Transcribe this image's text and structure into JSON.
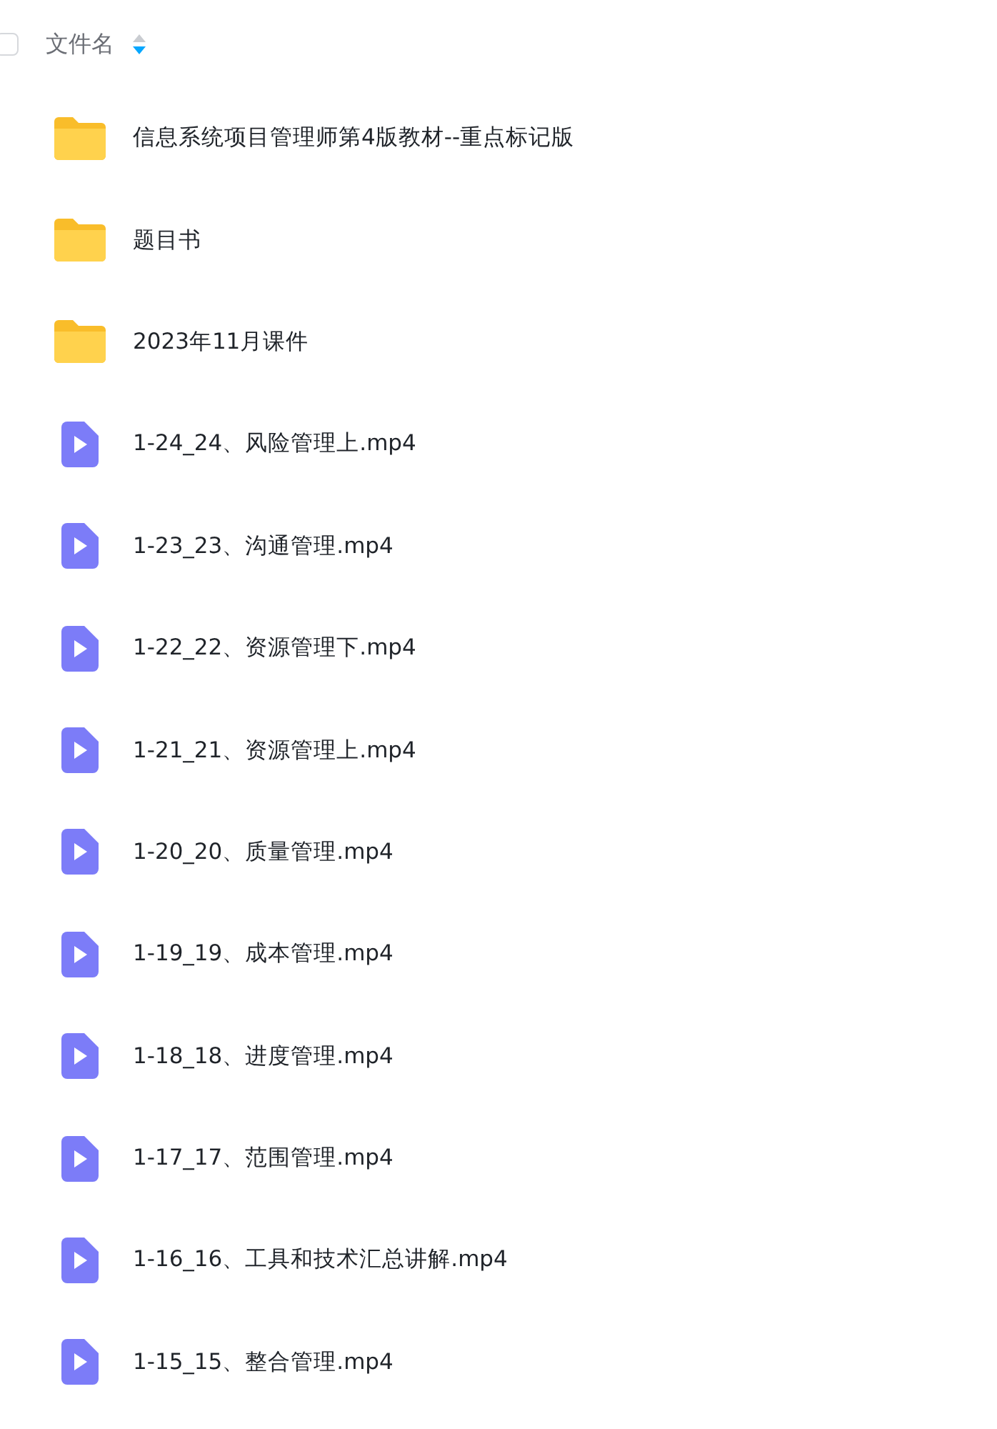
{
  "header": {
    "checked": false,
    "label": "文件名",
    "sort_descending": true
  },
  "files": [
    {
      "kind": "folder",
      "name": "信息系统项目管理师第4版教材--重点标记版"
    },
    {
      "kind": "folder",
      "name": "题目书"
    },
    {
      "kind": "folder",
      "name": "2023年11月课件"
    },
    {
      "kind": "video",
      "name": "1-24_24、风险管理上.mp4"
    },
    {
      "kind": "video",
      "name": "1-23_23、沟通管理.mp4"
    },
    {
      "kind": "video",
      "name": "1-22_22、资源管理下.mp4"
    },
    {
      "kind": "video",
      "name": "1-21_21、资源管理上.mp4"
    },
    {
      "kind": "video",
      "name": "1-20_20、质量管理.mp4"
    },
    {
      "kind": "video",
      "name": "1-19_19、成本管理.mp4"
    },
    {
      "kind": "video",
      "name": "1-18_18、进度管理.mp4"
    },
    {
      "kind": "video",
      "name": "1-17_17、范围管理.mp4"
    },
    {
      "kind": "video",
      "name": "1-16_16、工具和技术汇总讲解.mp4"
    },
    {
      "kind": "video",
      "name": "1-15_15、整合管理.mp4"
    }
  ]
}
